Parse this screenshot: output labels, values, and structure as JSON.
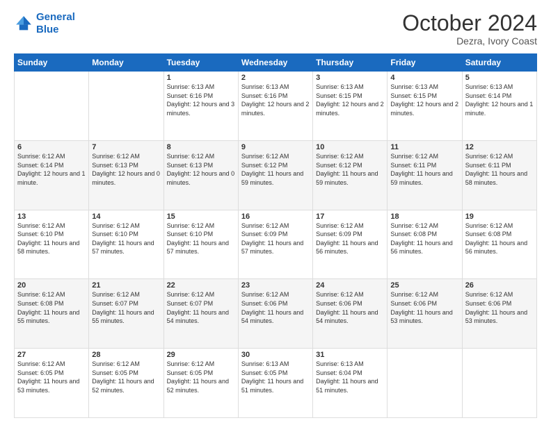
{
  "logo": {
    "line1": "General",
    "line2": "Blue"
  },
  "header": {
    "month": "October 2024",
    "location": "Dezra, Ivory Coast"
  },
  "days_of_week": [
    "Sunday",
    "Monday",
    "Tuesday",
    "Wednesday",
    "Thursday",
    "Friday",
    "Saturday"
  ],
  "weeks": [
    [
      null,
      null,
      {
        "day": 1,
        "sunrise": "6:13 AM",
        "sunset": "6:16 PM",
        "daylight": "12 hours and 3 minutes."
      },
      {
        "day": 2,
        "sunrise": "6:13 AM",
        "sunset": "6:16 PM",
        "daylight": "12 hours and 2 minutes."
      },
      {
        "day": 3,
        "sunrise": "6:13 AM",
        "sunset": "6:15 PM",
        "daylight": "12 hours and 2 minutes."
      },
      {
        "day": 4,
        "sunrise": "6:13 AM",
        "sunset": "6:15 PM",
        "daylight": "12 hours and 2 minutes."
      },
      {
        "day": 5,
        "sunrise": "6:13 AM",
        "sunset": "6:14 PM",
        "daylight": "12 hours and 1 minute."
      }
    ],
    [
      {
        "day": 6,
        "sunrise": "6:12 AM",
        "sunset": "6:14 PM",
        "daylight": "12 hours and 1 minute."
      },
      {
        "day": 7,
        "sunrise": "6:12 AM",
        "sunset": "6:13 PM",
        "daylight": "12 hours and 0 minutes."
      },
      {
        "day": 8,
        "sunrise": "6:12 AM",
        "sunset": "6:13 PM",
        "daylight": "12 hours and 0 minutes."
      },
      {
        "day": 9,
        "sunrise": "6:12 AM",
        "sunset": "6:12 PM",
        "daylight": "11 hours and 59 minutes."
      },
      {
        "day": 10,
        "sunrise": "6:12 AM",
        "sunset": "6:12 PM",
        "daylight": "11 hours and 59 minutes."
      },
      {
        "day": 11,
        "sunrise": "6:12 AM",
        "sunset": "6:11 PM",
        "daylight": "11 hours and 59 minutes."
      },
      {
        "day": 12,
        "sunrise": "6:12 AM",
        "sunset": "6:11 PM",
        "daylight": "11 hours and 58 minutes."
      }
    ],
    [
      {
        "day": 13,
        "sunrise": "6:12 AM",
        "sunset": "6:10 PM",
        "daylight": "11 hours and 58 minutes."
      },
      {
        "day": 14,
        "sunrise": "6:12 AM",
        "sunset": "6:10 PM",
        "daylight": "11 hours and 57 minutes."
      },
      {
        "day": 15,
        "sunrise": "6:12 AM",
        "sunset": "6:10 PM",
        "daylight": "11 hours and 57 minutes."
      },
      {
        "day": 16,
        "sunrise": "6:12 AM",
        "sunset": "6:09 PM",
        "daylight": "11 hours and 57 minutes."
      },
      {
        "day": 17,
        "sunrise": "6:12 AM",
        "sunset": "6:09 PM",
        "daylight": "11 hours and 56 minutes."
      },
      {
        "day": 18,
        "sunrise": "6:12 AM",
        "sunset": "6:08 PM",
        "daylight": "11 hours and 56 minutes."
      },
      {
        "day": 19,
        "sunrise": "6:12 AM",
        "sunset": "6:08 PM",
        "daylight": "11 hours and 56 minutes."
      }
    ],
    [
      {
        "day": 20,
        "sunrise": "6:12 AM",
        "sunset": "6:08 PM",
        "daylight": "11 hours and 55 minutes."
      },
      {
        "day": 21,
        "sunrise": "6:12 AM",
        "sunset": "6:07 PM",
        "daylight": "11 hours and 55 minutes."
      },
      {
        "day": 22,
        "sunrise": "6:12 AM",
        "sunset": "6:07 PM",
        "daylight": "11 hours and 54 minutes."
      },
      {
        "day": 23,
        "sunrise": "6:12 AM",
        "sunset": "6:06 PM",
        "daylight": "11 hours and 54 minutes."
      },
      {
        "day": 24,
        "sunrise": "6:12 AM",
        "sunset": "6:06 PM",
        "daylight": "11 hours and 54 minutes."
      },
      {
        "day": 25,
        "sunrise": "6:12 AM",
        "sunset": "6:06 PM",
        "daylight": "11 hours and 53 minutes."
      },
      {
        "day": 26,
        "sunrise": "6:12 AM",
        "sunset": "6:06 PM",
        "daylight": "11 hours and 53 minutes."
      }
    ],
    [
      {
        "day": 27,
        "sunrise": "6:12 AM",
        "sunset": "6:05 PM",
        "daylight": "11 hours and 53 minutes."
      },
      {
        "day": 28,
        "sunrise": "6:12 AM",
        "sunset": "6:05 PM",
        "daylight": "11 hours and 52 minutes."
      },
      {
        "day": 29,
        "sunrise": "6:12 AM",
        "sunset": "6:05 PM",
        "daylight": "11 hours and 52 minutes."
      },
      {
        "day": 30,
        "sunrise": "6:13 AM",
        "sunset": "6:05 PM",
        "daylight": "11 hours and 51 minutes."
      },
      {
        "day": 31,
        "sunrise": "6:13 AM",
        "sunset": "6:04 PM",
        "daylight": "11 hours and 51 minutes."
      },
      null,
      null
    ]
  ]
}
